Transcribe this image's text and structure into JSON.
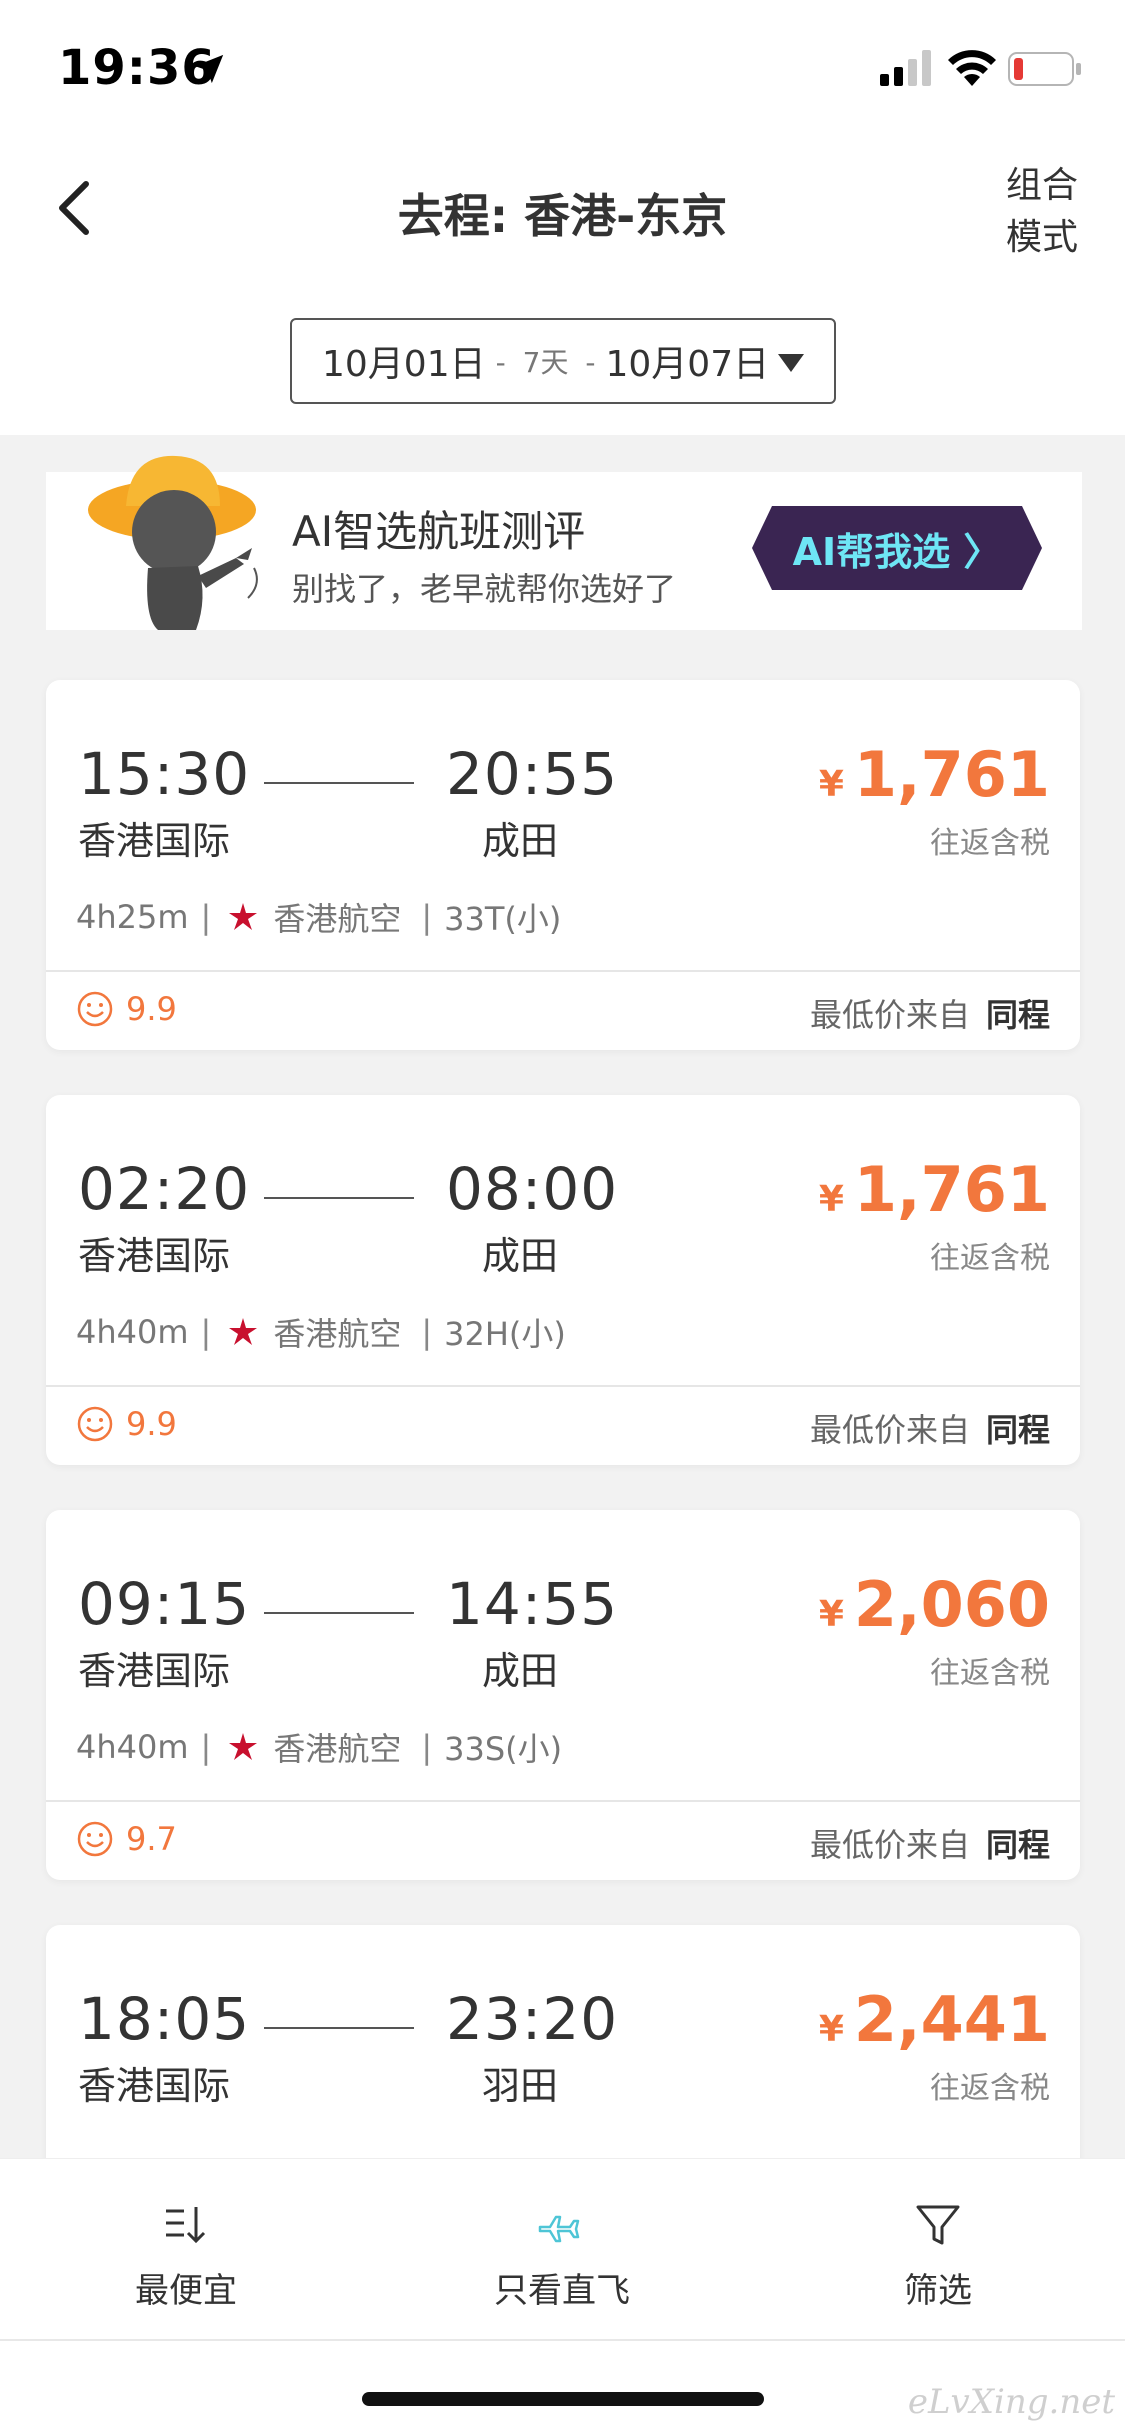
{
  "status_bar": {
    "time": "19:36"
  },
  "nav": {
    "title": "去程: 香港-东京",
    "mode_line1": "组合",
    "mode_line2": "模式"
  },
  "date_picker": {
    "depart": "10月01日",
    "separator1": "-",
    "duration": "7天",
    "separator2": "-",
    "return": "10月07日"
  },
  "ai_banner": {
    "title": "AI智选航班测评",
    "subtitle": "别找了，老早就帮你选好了",
    "button": "AI帮我选 〉"
  },
  "flights": [
    {
      "dep_time": "15:30",
      "arr_time": "20:55",
      "dep_airport": "香港国际",
      "arr_airport": "成田",
      "currency": "¥",
      "price": "1,761",
      "price_note": "往返含税",
      "duration": "4h25m",
      "airline": "香港航空",
      "aircraft": "33T(小)",
      "score": "9.9",
      "source_label": "最低价来自",
      "source": "同程"
    },
    {
      "dep_time": "02:20",
      "arr_time": "08:00",
      "dep_airport": "香港国际",
      "arr_airport": "成田",
      "currency": "¥",
      "price": "1,761",
      "price_note": "往返含税",
      "duration": "4h40m",
      "airline": "香港航空",
      "aircraft": "32H(小)",
      "score": "9.9",
      "source_label": "最低价来自",
      "source": "同程"
    },
    {
      "dep_time": "09:15",
      "arr_time": "14:55",
      "dep_airport": "香港国际",
      "arr_airport": "成田",
      "currency": "¥",
      "price": "2,060",
      "price_note": "往返含税",
      "duration": "4h40m",
      "airline": "香港航空",
      "aircraft": "33S(小)",
      "score": "9.7",
      "source_label": "最低价来自",
      "source": "同程"
    },
    {
      "dep_time": "18:05",
      "arr_time": "23:20",
      "dep_airport": "香港国际",
      "arr_airport": "羽田",
      "currency": "¥",
      "price": "2,441",
      "price_note": "往返含税"
    }
  ],
  "tabbar": {
    "cheapest": "最便宜",
    "direct": "只看直飞",
    "filter": "筛选"
  },
  "colors": {
    "price": "#f2773d",
    "accent": "#4ec5d6",
    "ai_button_bg": "#3a2552",
    "ai_button_text": "#6ee6f5"
  },
  "watermark": "eLvXing.net"
}
